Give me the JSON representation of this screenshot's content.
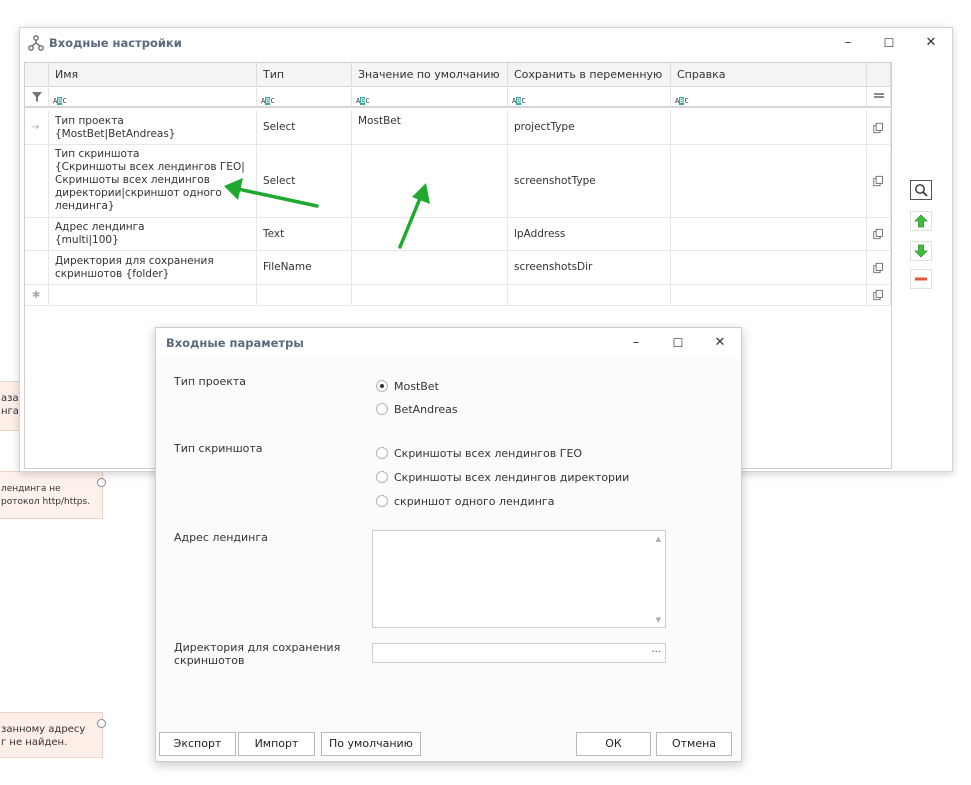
{
  "background": {
    "node1_lines": [
      "азан",
      "нга"
    ],
    "node2_lines": [
      "лендинга не",
      "ротокол http/https."
    ],
    "node3_lines": [
      "занному адресу",
      "г не найден."
    ]
  },
  "input_settings_window": {
    "title": "Входные настройки",
    "controls": {
      "minimize": "–",
      "maximize": "☐",
      "close": "✕"
    },
    "columns": [
      "Имя",
      "Тип",
      "Значение по умолчанию",
      "Сохранить в переменную",
      "Справка"
    ],
    "filter_placeholder_left": "A",
    "filter_placeholder_mid": "B",
    "filter_placeholder_right": "C",
    "rows": [
      {
        "name": "Тип проекта\n{MostBet|BetAndreas}",
        "type": "Select",
        "default": "MostBet",
        "variable": "projectType",
        "help": ""
      },
      {
        "name": "Тип скриншота\n{Скриншоты всех лендингов ГЕО|Скриншоты всех лендингов директории|скриншот одного лендинга}",
        "type": "Select",
        "default": "",
        "variable": "screenshotType",
        "help": ""
      },
      {
        "name": "Адрес лендинга\n{multi|100}",
        "type": "Text",
        "default": "",
        "variable": "lpAddress",
        "help": ""
      },
      {
        "name": "Директория для сохранения скриншотов {folder}",
        "type": "FileName",
        "default": "",
        "variable": "screenshotsDir",
        "help": ""
      }
    ],
    "new_row_marker": "✱",
    "current_row_marker": "→",
    "accent_arrow_color": "#1faa2f"
  },
  "input_params_window": {
    "title": "Входные параметры",
    "controls": {
      "minimize": "–",
      "maximize": "☐",
      "close": "✕"
    },
    "project_type": {
      "label": "Тип проекта",
      "options": [
        "MostBet",
        "BetAndreas"
      ],
      "selected": "MostBet"
    },
    "screenshot_type": {
      "label": "Тип скриншота",
      "options": [
        "Скриншоты всех лендингов ГЕО",
        "Скриншоты всех лендингов директории",
        "скриншот одного лендинга"
      ],
      "selected": ""
    },
    "landing_address": {
      "label": "Адрес лендинга",
      "value": ""
    },
    "directory": {
      "label": "Директория для сохранения скриншотов",
      "value": "",
      "browse": "···"
    },
    "buttons": {
      "export": "Экспорт",
      "import": "Импорт",
      "default": "По умолчанию",
      "ok": "ОК",
      "cancel": "Отмена"
    }
  }
}
